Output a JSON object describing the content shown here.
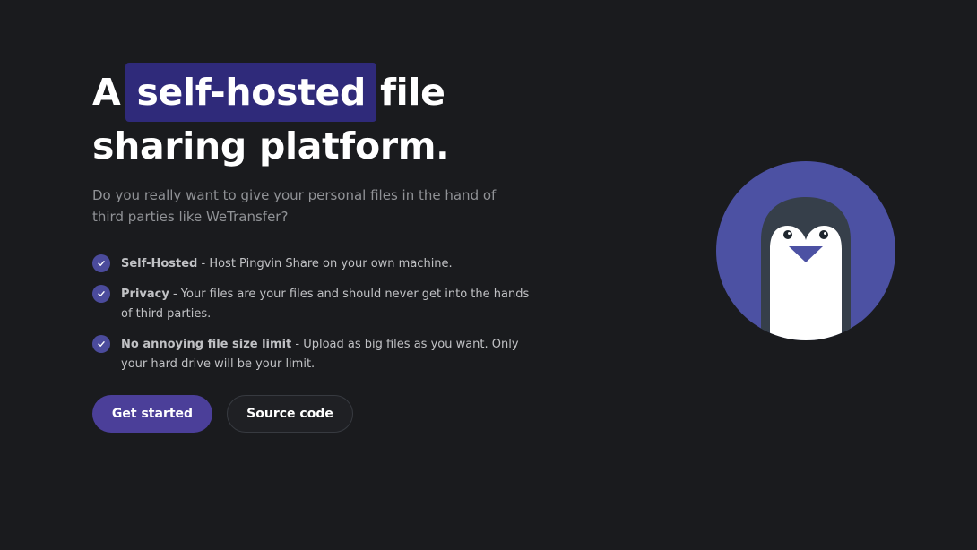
{
  "hero": {
    "title_before": "A",
    "title_highlight": "self-hosted",
    "title_after": "file",
    "title_line2": "sharing platform.",
    "subtitle": "Do you really want to give your personal files in the hand of third parties like WeTransfer?"
  },
  "features": [
    {
      "title": "Self-Hosted",
      "description": " - Host Pingvin Share on your own machine."
    },
    {
      "title": "Privacy",
      "description": " - Your files are your files and should never get into the hands of third parties."
    },
    {
      "title": "No annoying file size limit",
      "description": " - Upload as big files as you want. Only your hard drive will be your limit."
    }
  ],
  "buttons": {
    "primary_label": "Get started",
    "secondary_label": "Source code"
  },
  "icons": {
    "feature_check": "check-icon",
    "logo": "penguin-logo-icon"
  },
  "colors": {
    "background": "#1a1b1e",
    "accent": "#4b3f99",
    "highlight": "#2f2a7a",
    "logo_circle": "#4c51a3",
    "penguin_body": "#363f4a"
  }
}
